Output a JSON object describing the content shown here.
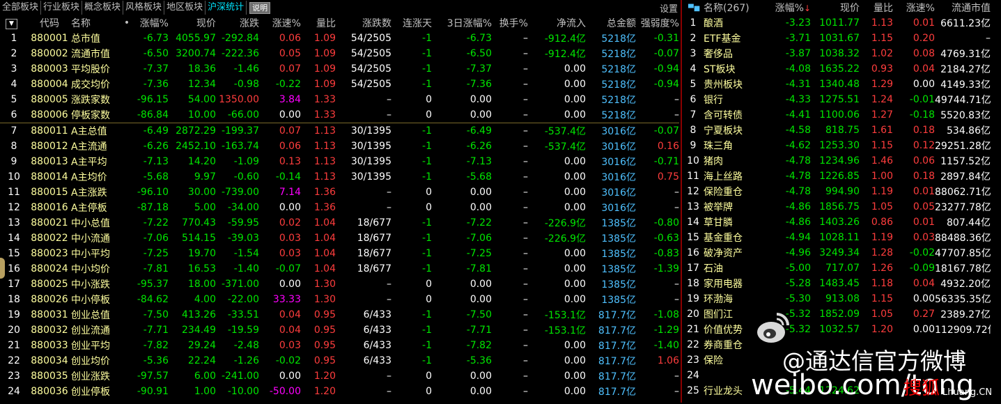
{
  "tabs": [
    "全部板块",
    "行业板块",
    "概念板块",
    "风格板块",
    "地区板块",
    "沪深统计"
  ],
  "active_tab": 5,
  "explain_btn": "说明",
  "settings_label": "设置",
  "left_headers": {
    "sort": "▼",
    "code": "代码",
    "name": "名称",
    "dot": "•",
    "chg_pct": "涨幅%",
    "price": "现价",
    "chg": "涨跌",
    "speed": "涨速%",
    "vol_ratio": "量比",
    "adv_dec": "涨跌数",
    "cons_up": "连涨天",
    "chg3": "3日涨幅%",
    "turnover": "换手%",
    "net_in": "净流入",
    "amount": "总金额",
    "strength": "强弱度%"
  },
  "left_rows": [
    {
      "i": "1",
      "code": "880001",
      "name": "总市值",
      "chg_pct": "-6.73",
      "price": "4055.97",
      "chg": "-292.84",
      "speed": "0.06",
      "vr": "1.09",
      "ad": "54/2505",
      "cu": "-1",
      "c3": "-6.73",
      "to": "–",
      "ni": "-912.4亿",
      "amt": "5218亿",
      "st": "-0.31"
    },
    {
      "i": "2",
      "code": "880002",
      "name": "流通市值",
      "chg_pct": "-6.50",
      "price": "3200.74",
      "chg": "-222.36",
      "speed": "0.05",
      "vr": "1.09",
      "ad": "54/2505",
      "cu": "-1",
      "c3": "-6.50",
      "to": "–",
      "ni": "-912.4亿",
      "amt": "5218亿",
      "st": "-0.07"
    },
    {
      "i": "3",
      "code": "880003",
      "name": "平均股价",
      "chg_pct": "-7.37",
      "price": "18.36",
      "chg": "-1.46",
      "speed": "0.07",
      "vr": "1.09",
      "ad": "54/2505",
      "cu": "-1",
      "c3": "-7.37",
      "to": "–",
      "ni": "0.00",
      "amt": "5218亿",
      "st": "-0.94"
    },
    {
      "i": "4",
      "code": "880004",
      "name": "成交均价",
      "chg_pct": "-7.36",
      "price": "12.34",
      "chg": "-0.98",
      "speed": "-0.22",
      "vr": "1.09",
      "ad": "54/2505",
      "cu": "-1",
      "c3": "-7.36",
      "to": "–",
      "ni": "0.00",
      "amt": "5218亿",
      "st": "-0.94"
    },
    {
      "i": "5",
      "code": "880005",
      "name": "涨跌家数",
      "chg_pct": "-96.15",
      "price": "54.00",
      "chg": "1350.00",
      "speed": "3.84",
      "vr": "1.33",
      "ad": "–",
      "cu": "0",
      "c3": "0.00",
      "to": "–",
      "ni": "0.00",
      "amt": "5218亿",
      "st": "–"
    },
    {
      "i": "6",
      "code": "880006",
      "name": "停板家数",
      "chg_pct": "-86.84",
      "price": "10.00",
      "chg": "-66.00",
      "speed": "0.00",
      "vr": "1.33",
      "ad": "–",
      "cu": "0",
      "c3": "0.00",
      "to": "–",
      "ni": "0.00",
      "amt": "5218亿",
      "st": "–"
    },
    {
      "i": "7",
      "code": "880011",
      "name": "A主总值",
      "chg_pct": "-6.49",
      "price": "2872.29",
      "chg": "-199.37",
      "speed": "0.07",
      "vr": "1.13",
      "ad": "30/1395",
      "cu": "-1",
      "c3": "-6.49",
      "to": "–",
      "ni": "-537.4亿",
      "amt": "3016亿",
      "st": "-0.07"
    },
    {
      "i": "8",
      "code": "880012",
      "name": "A主流通",
      "chg_pct": "-6.26",
      "price": "2452.10",
      "chg": "-163.74",
      "speed": "0.06",
      "vr": "1.13",
      "ad": "30/1395",
      "cu": "-1",
      "c3": "-6.26",
      "to": "–",
      "ni": "-537.4亿",
      "amt": "3016亿",
      "st": "0.16"
    },
    {
      "i": "9",
      "code": "880013",
      "name": "A主平均",
      "chg_pct": "-7.13",
      "price": "14.20",
      "chg": "-1.09",
      "speed": "0.13",
      "vr": "1.13",
      "ad": "30/1395",
      "cu": "-1",
      "c3": "-7.13",
      "to": "–",
      "ni": "0.00",
      "amt": "3016亿",
      "st": "-0.71"
    },
    {
      "i": "10",
      "code": "880014",
      "name": "A主均价",
      "chg_pct": "-5.68",
      "price": "9.97",
      "chg": "-0.60",
      "speed": "-0.14",
      "vr": "1.13",
      "ad": "30/1395",
      "cu": "-1",
      "c3": "-5.68",
      "to": "–",
      "ni": "0.00",
      "amt": "3016亿",
      "st": "0.75"
    },
    {
      "i": "11",
      "code": "880015",
      "name": "A主涨跌",
      "chg_pct": "-96.10",
      "price": "30.00",
      "chg": "-739.00",
      "speed": "7.14",
      "vr": "1.36",
      "ad": "–",
      "cu": "0",
      "c3": "0.00",
      "to": "–",
      "ni": "0.00",
      "amt": "3016亿",
      "st": "–"
    },
    {
      "i": "12",
      "code": "880016",
      "name": "A主停板",
      "chg_pct": "-87.18",
      "price": "5.00",
      "chg": "-34.00",
      "speed": "0.00",
      "vr": "1.36",
      "ad": "–",
      "cu": "0",
      "c3": "0.00",
      "to": "–",
      "ni": "0.00",
      "amt": "3016亿",
      "st": "–"
    },
    {
      "i": "13",
      "code": "880021",
      "name": "中小总值",
      "chg_pct": "-7.22",
      "price": "770.43",
      "chg": "-59.95",
      "speed": "0.02",
      "vr": "1.04",
      "ad": "18/677",
      "cu": "-1",
      "c3": "-7.22",
      "to": "–",
      "ni": "-226.9亿",
      "amt": "1385亿",
      "st": "-0.80"
    },
    {
      "i": "14",
      "code": "880022",
      "name": "中小流通",
      "chg_pct": "-7.06",
      "price": "514.15",
      "chg": "-39.03",
      "speed": "0.03",
      "vr": "1.04",
      "ad": "18/677",
      "cu": "-1",
      "c3": "-7.06",
      "to": "–",
      "ni": "-226.9亿",
      "amt": "1385亿",
      "st": "-0.63"
    },
    {
      "i": "15",
      "code": "880023",
      "name": "中小平均",
      "chg_pct": "-7.25",
      "price": "19.70",
      "chg": "-1.54",
      "speed": "0.03",
      "vr": "1.04",
      "ad": "18/677",
      "cu": "-1",
      "c3": "-7.25",
      "to": "–",
      "ni": "0.00",
      "amt": "1385亿",
      "st": "-0.83"
    },
    {
      "i": "16",
      "code": "880024",
      "name": "中小均价",
      "chg_pct": "-7.81",
      "price": "16.53",
      "chg": "-1.40",
      "speed": "-0.07",
      "vr": "1.04",
      "ad": "18/677",
      "cu": "-1",
      "c3": "-7.81",
      "to": "–",
      "ni": "0.00",
      "amt": "1385亿",
      "st": "-1.39"
    },
    {
      "i": "17",
      "code": "880025",
      "name": "中小涨跌",
      "chg_pct": "-95.37",
      "price": "18.00",
      "chg": "-371.00",
      "speed": "0.00",
      "vr": "1.30",
      "ad": "–",
      "cu": "0",
      "c3": "0.00",
      "to": "–",
      "ni": "0.00",
      "amt": "1385亿",
      "st": "–"
    },
    {
      "i": "18",
      "code": "880026",
      "name": "中小停板",
      "chg_pct": "-84.62",
      "price": "4.00",
      "chg": "-22.00",
      "speed": "33.33",
      "vr": "1.30",
      "ad": "–",
      "cu": "0",
      "c3": "0.00",
      "to": "–",
      "ni": "0.00",
      "amt": "1385亿",
      "st": "–"
    },
    {
      "i": "19",
      "code": "880031",
      "name": "创业总值",
      "chg_pct": "-7.50",
      "price": "413.26",
      "chg": "-33.51",
      "speed": "0.04",
      "vr": "0.95",
      "ad": "6/433",
      "cu": "-1",
      "c3": "-7.50",
      "to": "–",
      "ni": "-153.1亿",
      "amt": "817.7亿",
      "st": "-1.08"
    },
    {
      "i": "20",
      "code": "880032",
      "name": "创业流通",
      "chg_pct": "-7.71",
      "price": "234.49",
      "chg": "-19.59",
      "speed": "0.04",
      "vr": "0.95",
      "ad": "6/433",
      "cu": "-1",
      "c3": "-7.71",
      "to": "–",
      "ni": "-153.1亿",
      "amt": "817.7亿",
      "st": "-1.29"
    },
    {
      "i": "21",
      "code": "880033",
      "name": "创业平均",
      "chg_pct": "-7.82",
      "price": "29.24",
      "chg": "-2.48",
      "speed": "0.03",
      "vr": "0.95",
      "ad": "6/433",
      "cu": "-1",
      "c3": "-7.82",
      "to": "–",
      "ni": "0.00",
      "amt": "817.7亿",
      "st": "-1.40"
    },
    {
      "i": "22",
      "code": "880034",
      "name": "创业均价",
      "chg_pct": "-5.36",
      "price": "22.24",
      "chg": "-1.26",
      "speed": "-0.02",
      "vr": "0.95",
      "ad": "6/433",
      "cu": "-1",
      "c3": "-5.36",
      "to": "–",
      "ni": "0.00",
      "amt": "817.7亿",
      "st": "1.06"
    },
    {
      "i": "23",
      "code": "880035",
      "name": "创业涨跌",
      "chg_pct": "-97.57",
      "price": "6.00",
      "chg": "-241.00",
      "speed": "0.00",
      "vr": "1.20",
      "ad": "–",
      "cu": "0",
      "c3": "0.00",
      "to": "–",
      "ni": "0.00",
      "amt": "817.7亿",
      "st": "–"
    },
    {
      "i": "24",
      "code": "880036",
      "name": "创业停板",
      "chg_pct": "-90.91",
      "price": "1.00",
      "chg": "-10.00",
      "speed": "-50.00",
      "vr": "1.20",
      "ad": "–",
      "cu": "0",
      "c3": "0.00",
      "to": "–",
      "ni": "0.00",
      "amt": "817.7亿",
      "st": "–"
    }
  ],
  "right_headers": {
    "name": "名称(267)",
    "chg_pct": "涨幅%",
    "price": "现价",
    "vol_ratio": "量比",
    "speed": "涨速%",
    "cap": "流通市值"
  },
  "right_rows": [
    {
      "i": "1",
      "name": "酿酒",
      "chg": "-3.23",
      "price": "1011.77",
      "vr": "1.13",
      "sp": "0.01",
      "cap": "6611.23亿"
    },
    {
      "i": "2",
      "name": "ETF基金",
      "chg": "-3.71",
      "price": "1031.67",
      "vr": "1.15",
      "sp": "0.20",
      "cap": "–"
    },
    {
      "i": "3",
      "name": "奢侈品",
      "chg": "-3.87",
      "price": "1038.32",
      "vr": "1.02",
      "sp": "0.08",
      "cap": "4769.31亿"
    },
    {
      "i": "4",
      "name": "ST板块",
      "chg": "-4.08",
      "price": "1635.22",
      "vr": "0.93",
      "sp": "0.04",
      "cap": "2184.27亿"
    },
    {
      "i": "5",
      "name": "贵州板块",
      "chg": "-4.31",
      "price": "1340.48",
      "vr": "1.29",
      "sp": "0.00",
      "cap": "4149.33亿"
    },
    {
      "i": "6",
      "name": "银行",
      "chg": "-4.33",
      "price": "1275.51",
      "vr": "1.24",
      "sp": "-0.01",
      "cap": "49744.71亿"
    },
    {
      "i": "7",
      "name": "含可转债",
      "chg": "-4.41",
      "price": "1100.06",
      "vr": "1.27",
      "sp": "-0.18",
      "cap": "5520.83亿"
    },
    {
      "i": "8",
      "name": "宁夏板块",
      "chg": "-4.58",
      "price": "818.75",
      "vr": "1.61",
      "sp": "0.18",
      "cap": "534.86亿"
    },
    {
      "i": "9",
      "name": "珠三角",
      "chg": "-4.62",
      "price": "1253.30",
      "vr": "1.15",
      "sp": "0.12",
      "cap": "29251.28亿"
    },
    {
      "i": "10",
      "name": "猪肉",
      "chg": "-4.78",
      "price": "1234.96",
      "vr": "1.46",
      "sp": "0.06",
      "cap": "1157.52亿"
    },
    {
      "i": "11",
      "name": "海上丝路",
      "chg": "-4.78",
      "price": "1226.85",
      "vr": "1.00",
      "sp": "0.18",
      "cap": "2897.84亿"
    },
    {
      "i": "12",
      "name": "保险重仓",
      "chg": "-4.78",
      "price": "994.90",
      "vr": "1.19",
      "sp": "0.01",
      "cap": "88062.71亿"
    },
    {
      "i": "13",
      "name": "被举牌",
      "chg": "-4.86",
      "price": "1856.75",
      "vr": "1.05",
      "sp": "0.05",
      "cap": "23277.78亿"
    },
    {
      "i": "14",
      "name": "草甘膦",
      "chg": "-4.86",
      "price": "1403.26",
      "vr": "0.86",
      "sp": "0.01",
      "cap": "807.44亿"
    },
    {
      "i": "15",
      "name": "基金重仓",
      "chg": "-4.94",
      "price": "1028.11",
      "vr": "1.19",
      "sp": "0.03",
      "cap": "88488.36亿"
    },
    {
      "i": "16",
      "name": "破净资产",
      "chg": "-4.96",
      "price": "3249.34",
      "vr": "1.28",
      "sp": "-0.02",
      "cap": "47707.85亿"
    },
    {
      "i": "17",
      "name": "石油",
      "chg": "-5.00",
      "price": "717.07",
      "vr": "1.26",
      "sp": "-0.09",
      "cap": "18167.78亿"
    },
    {
      "i": "18",
      "name": "家用电器",
      "chg": "-5.28",
      "price": "1483.45",
      "vr": "1.18",
      "sp": "0.04",
      "cap": "4932.20亿"
    },
    {
      "i": "19",
      "name": "环渤海",
      "chg": "-5.30",
      "price": "913.08",
      "vr": "1.15",
      "sp": "0.00",
      "cap": "56335.35亿"
    },
    {
      "i": "20",
      "name": "图们江",
      "chg": "-5.32",
      "price": "1852.09",
      "vr": "1.05",
      "sp": "0.27",
      "cap": "2389.27亿"
    },
    {
      "i": "21",
      "name": "价值优势",
      "chg": "-5.32",
      "price": "1032.57",
      "vr": "1.20",
      "sp": "0.00",
      "cap": "112909.72亿"
    },
    {
      "i": "22",
      "name": "券商重仓",
      "chg": "",
      "price": "",
      "vr": "",
      "sp": "",
      "cap": ""
    },
    {
      "i": "23",
      "name": "保险",
      "chg": "",
      "price": "",
      "vr": "",
      "sp": "",
      "cap": ""
    },
    {
      "i": "24",
      "name": "",
      "chg": "",
      "price": "",
      "vr": "",
      "sp": "",
      "cap": ""
    },
    {
      "i": "25",
      "name": "行业龙头",
      "chg": "-5.44",
      "price": "1224.62",
      "vr": "",
      "sp": "",
      "cap": ""
    }
  ],
  "watermark": {
    "line1": "@通达信官方微博",
    "line2": "weibo.com/tong",
    "site": "Lhuang.CN",
    "site_brand": "搜狐"
  },
  "colors": {
    "up": "#ff3d3d",
    "down": "#00e600",
    "neutral": "#ffffff",
    "amount": "#4fc1ff",
    "magenta": "#ff00ff",
    "label": "#ffff9f"
  }
}
